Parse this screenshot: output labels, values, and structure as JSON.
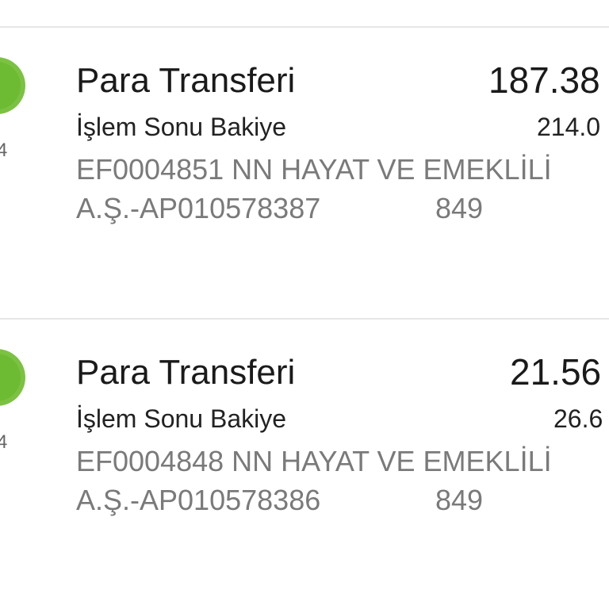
{
  "transactions": [
    {
      "side_date_fragment": "4",
      "title": "Para Transferi",
      "amount": "187.38",
      "balance_label": "İşlem Sonu Bakiye",
      "balance_value": "214.0",
      "description_line1": "EF0004851 NN HAYAT VE EMEKLİLİ",
      "description_line2": "A.Ş.-AP010578387",
      "description_suffix": "849"
    },
    {
      "side_date_fragment": "4",
      "title": "Para Transferi",
      "amount": "21.56",
      "balance_label": "İşlem Sonu Bakiye",
      "balance_value": "26.6",
      "description_line1": "EF0004848 NN HAYAT VE EMEKLİLİ",
      "description_line2": "A.Ş.-AP010578386",
      "description_suffix": "849"
    }
  ],
  "colors": {
    "status_dot": "#6dbb32",
    "divider": "#e6e6e6",
    "muted_text": "#7a7a7a"
  }
}
